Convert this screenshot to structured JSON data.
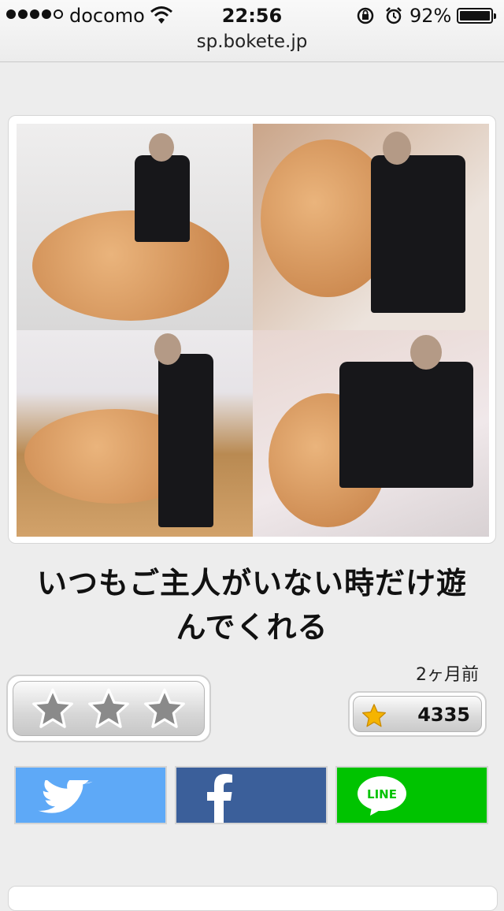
{
  "status_bar": {
    "carrier": "docomo",
    "time": "22:56",
    "battery": "92%"
  },
  "browser": {
    "url": "sp.bokete.jp"
  },
  "post": {
    "caption_line1": "いつもご主人がいない時だけ遊",
    "caption_line2": "んでくれる",
    "posted_ago": "2ヶ月前",
    "star_count": "4335",
    "rating_stars": 3
  },
  "share": {
    "twitter_icon": "twitter-bird-icon",
    "facebook_icon": "facebook-f-icon",
    "line_label": "LINE"
  },
  "colors": {
    "twitter": "#5ea9f7",
    "facebook": "#3b5f9a",
    "line": "#00c300",
    "star_gold": "#f5b400"
  }
}
